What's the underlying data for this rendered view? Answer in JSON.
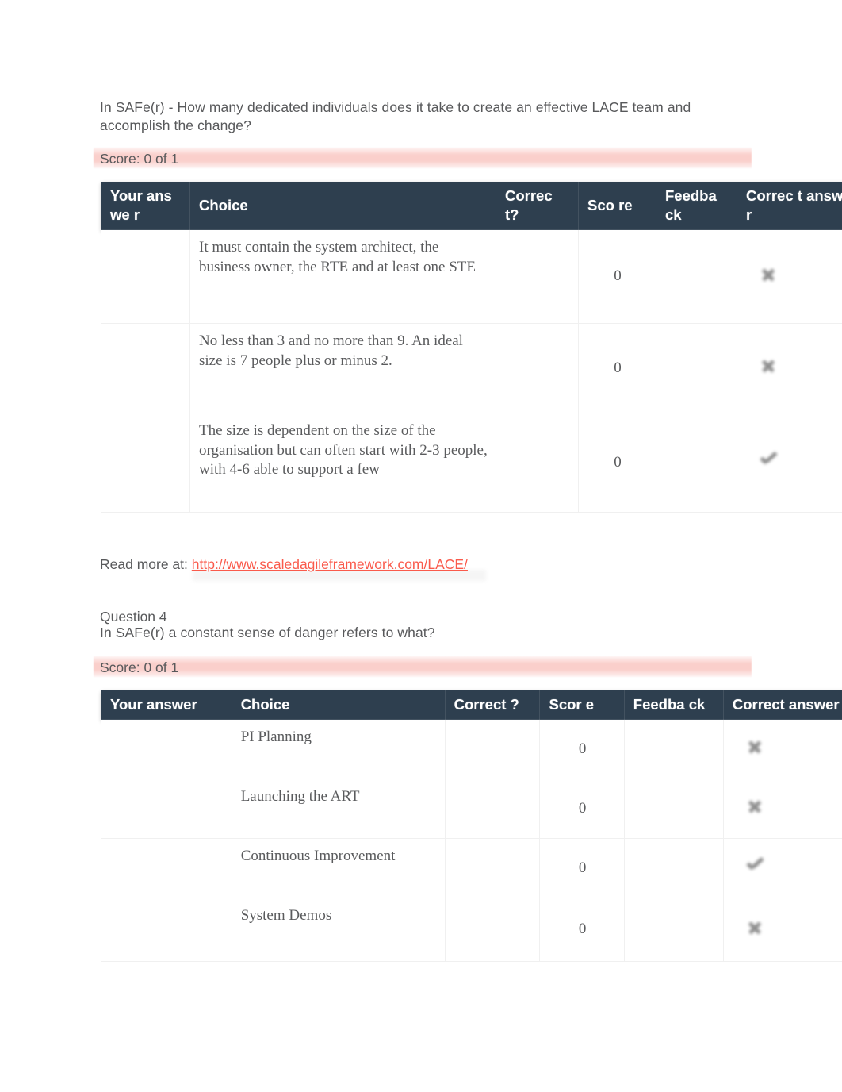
{
  "document": {
    "background": "#ffffff",
    "header_color": "#2e3f4f",
    "score_bar_color": "#facdc9",
    "link_color": "#fa5a4b",
    "text_color": "#58595b"
  },
  "questions": [
    {
      "label": "",
      "prompt": "In SAFe(r) - How many dedicated individuals does it take to create an effective LACE team and accomplish the change?",
      "score_text": "Score: 0 of 1",
      "columns": [
        "Your answe r",
        "Choice",
        "Correc t?",
        "Sco re",
        "Feedba ck",
        "Correc t answer"
      ],
      "rows": [
        {
          "your_answer": "",
          "choice": "It must contain the system architect, the business owner, the RTE and at least one STE",
          "correct": "",
          "score": "0",
          "feedback": "",
          "correct_answer_icon": "cross-icon"
        },
        {
          "your_answer": "",
          "choice": "No less than 3 and no more than 9. An ideal size is 7 people plus or minus 2.",
          "correct": "",
          "score": "0",
          "feedback": "",
          "correct_answer_icon": "cross-icon"
        },
        {
          "your_answer": "",
          "choice": "The size is dependent on the size of the organisation but can often start with 2-3 people, with 4-6 able to support a few",
          "correct": "",
          "score": "0",
          "feedback": "",
          "correct_answer_icon": "check-icon"
        }
      ],
      "read_more_label": "Read more at:",
      "read_more_link": "http://www.scaledagileframework.com/LACE/"
    },
    {
      "label": "Question 4",
      "prompt": "In SAFe(r) a constant sense of danger refers to what?",
      "score_text": "Score: 0 of 1",
      "columns": [
        "Your answer",
        "Choice",
        "Correct ?",
        "Scor e",
        "Feedba ck",
        "Correct answer"
      ],
      "rows": [
        {
          "your_answer": "",
          "choice": "PI Planning",
          "correct": "",
          "score": "0",
          "feedback": "",
          "correct_answer_icon": "cross-icon"
        },
        {
          "your_answer": "",
          "choice": "Launching the ART",
          "correct": "",
          "score": "0",
          "feedback": "",
          "correct_answer_icon": "cross-icon"
        },
        {
          "your_answer": "",
          "choice": "Continuous Improvement",
          "correct": "",
          "score": "0",
          "feedback": "",
          "correct_answer_icon": "check-icon"
        },
        {
          "your_answer": "",
          "choice": "System Demos",
          "correct": "",
          "score": "0",
          "feedback": "",
          "correct_answer_icon": "cross-icon"
        }
      ],
      "read_more_label": "",
      "read_more_link": ""
    }
  ]
}
